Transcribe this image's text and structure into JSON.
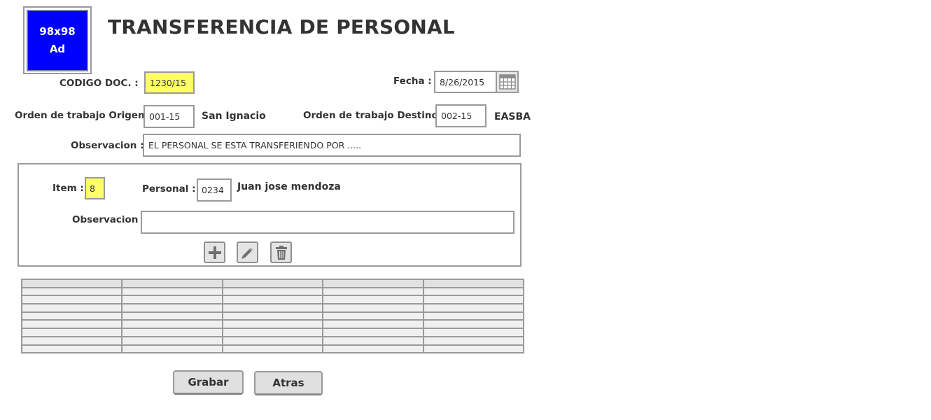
{
  "ad": {
    "line1": "98x98",
    "line2": "Ad"
  },
  "page_title": "TRANSFERENCIA DE PERSONAL",
  "codigo": {
    "label": "CODIGO DOC. :",
    "value": "1230/15"
  },
  "fecha": {
    "label": "Fecha :",
    "value": "8/26/2015",
    "icon": "calendar-icon"
  },
  "origen": {
    "label": "Orden de trabajo Origen :",
    "value": "001-15",
    "name": "San Ignacio"
  },
  "destino": {
    "label": "Orden de trabajo Destino :",
    "value": "002-15",
    "name": "EASBA"
  },
  "observacion": {
    "label": "Observacion :",
    "value": "EL PERSONAL SE ESTA TRANSFERIENDO POR ....."
  },
  "detail": {
    "item_label": "Item :",
    "item_value": "8",
    "personal_label": "Personal :",
    "personal_code": "0234",
    "personal_name": "Juan jose mendoza",
    "observacion_label": "Observacion :",
    "observacion_value": "",
    "icons": [
      "plus-icon",
      "pencil-icon",
      "trash-icon"
    ]
  },
  "grid": {
    "columns": 5,
    "rows": 8,
    "header": [
      "",
      "",
      "",
      "",
      ""
    ]
  },
  "buttons": {
    "save": "Grabar",
    "back": "Atras"
  },
  "colors": {
    "accent_yellow": "#ffff66",
    "ad_blue": "#0000ff",
    "border_gray": "#9a9a9a"
  }
}
